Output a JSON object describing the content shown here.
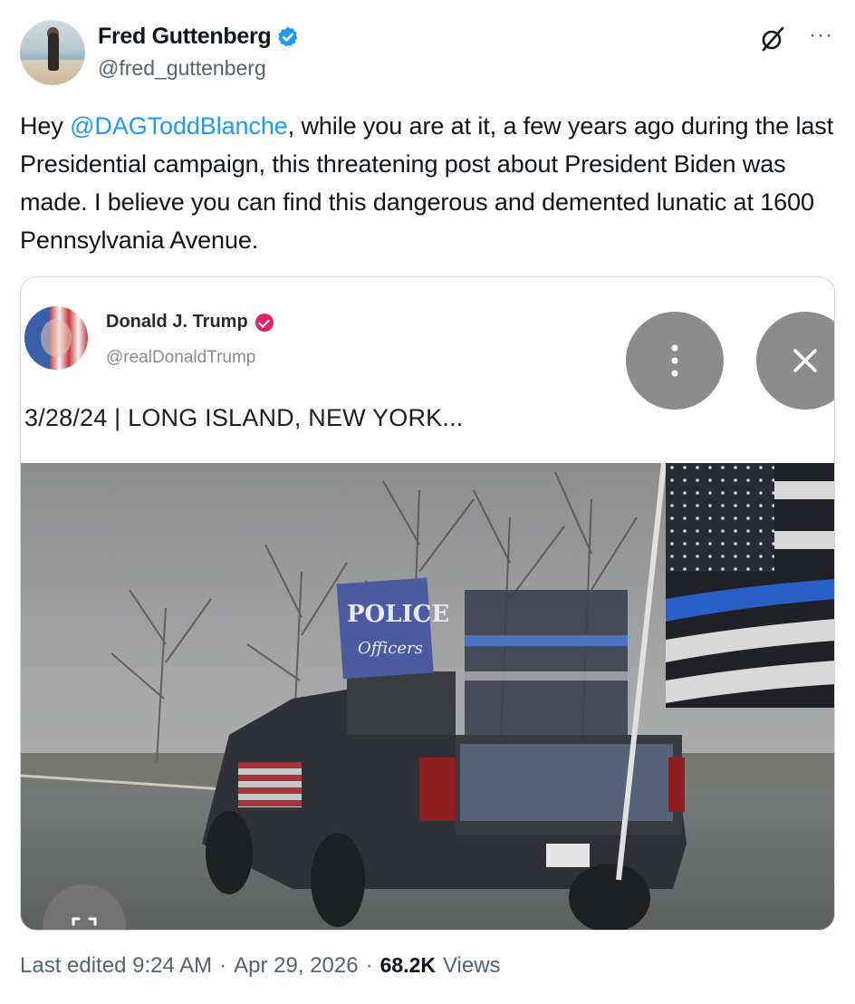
{
  "author": {
    "name": "Fred Guttenberg",
    "handle": "@fred_guttenberg",
    "verified": true,
    "verified_color": "#1d9bf0"
  },
  "header_icons": [
    "grok-icon",
    "more-icon"
  ],
  "tweet": {
    "text_prefix": "Hey ",
    "mention": "@DAGToddBlanche",
    "text_suffix": ", while you are at it, a few years ago during the last Presidential campaign, this threatening post about President Biden was made.  I believe you can find this dangerous and demented lunatic at 1600 Pennsylvania Avenue."
  },
  "embedded_post": {
    "name": "Donald J. Trump",
    "handle": "@realDonaldTrump",
    "badge_color": "#e0245e",
    "caption": "3/28/24 | LONG ISLAND, NEW YORK...",
    "photo_signs": [
      "POLICE",
      "Officers"
    ]
  },
  "overlay_buttons": [
    "more-options-icon",
    "close-icon",
    "expand-icon"
  ],
  "footer": {
    "edited_label": "Last edited 9:24 AM",
    "separator": "·",
    "date": "Apr 29, 2026",
    "views_count": "68.2K",
    "views_label": "Views"
  },
  "colors": {
    "link": "#1d9bf0",
    "secondary_text": "#536471",
    "primary_text": "#0f1419"
  }
}
